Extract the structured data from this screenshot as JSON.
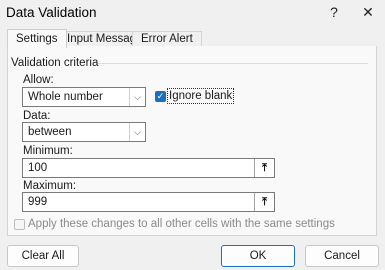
{
  "window": {
    "title": "Data Validation",
    "help_label": "?",
    "close_label": "✕"
  },
  "tabs": [
    {
      "label": "Settings",
      "active": true
    },
    {
      "label": "Input Message",
      "active": false
    },
    {
      "label": "Error Alert",
      "active": false
    }
  ],
  "settings": {
    "section_title": "Validation criteria",
    "allow_label": "Allow:",
    "allow_value": "Whole number",
    "ignore_blank_label": "Ignore blank",
    "ignore_blank_checked": true,
    "data_label": "Data:",
    "data_value": "between",
    "minimum_label": "Minimum:",
    "minimum_value": "100",
    "maximum_label": "Maximum:",
    "maximum_value": "999",
    "apply_all_label": "Apply these changes to all other cells with the same settings",
    "apply_all_checked": false
  },
  "buttons": {
    "clear_all": "Clear All",
    "ok": "OK",
    "cancel": "Cancel"
  },
  "icons": {
    "dropdown": "chevron-down-icon",
    "range_ref": "collapse-dialog-icon",
    "check": "checkmark-icon"
  },
  "colors": {
    "accent": "#1c6fc1",
    "background": "#f0f0f0",
    "panel": "#f9f9f9"
  }
}
